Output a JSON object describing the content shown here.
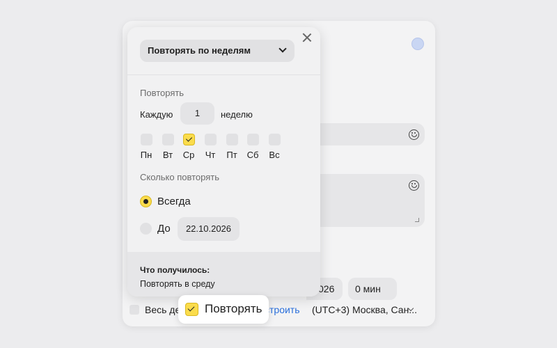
{
  "background": {
    "date_tail": "026",
    "duration": "0 мин",
    "all_day_label": "Весь ден",
    "configure_link": "строить",
    "timezone": "(UTC+3) Москва, Сан..."
  },
  "popup": {
    "repeat_mode": "Повторять по неделям",
    "repeat_section": "Повторять",
    "every_label": "Каждую",
    "interval": "1",
    "interval_unit": "неделю",
    "days": [
      {
        "name": "Пн",
        "checked": false
      },
      {
        "name": "Вт",
        "checked": false
      },
      {
        "name": "Ср",
        "checked": true
      },
      {
        "name": "Чт",
        "checked": false
      },
      {
        "name": "Пт",
        "checked": false
      },
      {
        "name": "Сб",
        "checked": false
      },
      {
        "name": "Вс",
        "checked": false
      }
    ],
    "count_section": "Сколько повторять",
    "options": [
      {
        "label": "Всегда",
        "selected": true
      },
      {
        "label": "До",
        "selected": false
      }
    ],
    "until_date": "22.10.2026",
    "summary_title": "Что получилось:",
    "summary_text": "Повторять в среду"
  },
  "repeat_toggle": {
    "label": "Повторять",
    "checked": true
  },
  "colors": {
    "accent": "#fbdc4c",
    "link": "#2a6fdb"
  }
}
